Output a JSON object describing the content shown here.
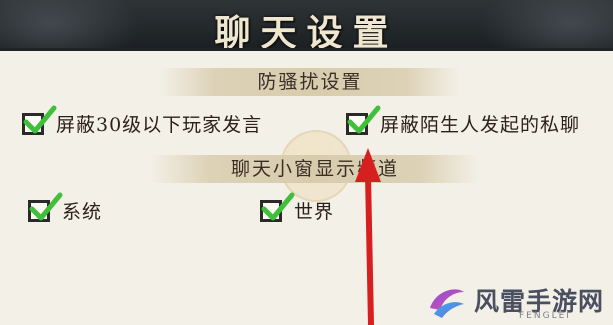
{
  "header": {
    "title": "聊天设置"
  },
  "sections": {
    "anti_harass": {
      "title": "防骚扰设置",
      "options": [
        {
          "label": "屏蔽30级以下玩家发言",
          "checked": true
        },
        {
          "label": "屏蔽陌生人发起的私聊",
          "checked": true
        }
      ]
    },
    "chat_window": {
      "title": "聊天小窗显示频道",
      "options": [
        {
          "label": "系统",
          "checked": true
        },
        {
          "label": "世界",
          "checked": true
        }
      ]
    }
  },
  "watermark": {
    "brand_cn": "风雷手游网",
    "brand_en": "FENGLEI"
  },
  "colors": {
    "check_green": "#3fbf3a",
    "arrow_red": "#d81f1f",
    "header_dark": "#23282b"
  }
}
